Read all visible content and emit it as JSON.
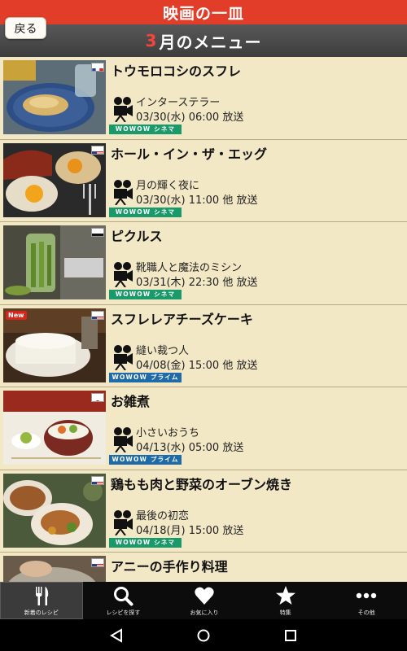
{
  "app": {
    "title": "映画の一皿",
    "back_label": "戻る",
    "month_number": "3",
    "month_suffix": "月のメニュー"
  },
  "colors": {
    "brand_red": "#e13d28",
    "wowow_cinema": "#1a9a6a",
    "wowow_prime": "#1f6aa8"
  },
  "recipes": [
    {
      "title": "トウモロコシのスフレ",
      "movie": "インターステラー",
      "air": "03/30(水) 06:00 放送",
      "channel": "WOWOW シネマ",
      "flag": "france-flag",
      "is_new": false
    },
    {
      "title": "ホール・イン・ザ・エッグ",
      "movie": "月の輝く夜に",
      "air": "03/30(水) 11:00 他 放送",
      "channel": "WOWOW シネマ",
      "flag": "usa-flag",
      "is_new": false
    },
    {
      "title": "ピクルス",
      "movie": "靴職人と魔法のミシン",
      "air": "03/31(木) 22:30 他 放送",
      "channel": "WOWOW シネマ",
      "flag": "germany-flag",
      "is_new": false
    },
    {
      "title": "スフレレアチーズケーキ",
      "movie": "縫い裁つ人",
      "air": "04/08(金) 15:00 他 放送",
      "channel": "WOWOW プライム",
      "flag": "usa-flag",
      "is_new": true,
      "new_label": "New"
    },
    {
      "title": "お雑煮",
      "movie": "小さいおうち",
      "air": "04/13(水) 05:00 放送",
      "channel": "WOWOW プライム",
      "flag": "japan-flag",
      "is_new": false
    },
    {
      "title": "鶏もも肉と野菜のオーブン焼き",
      "movie": "最後の初恋",
      "air": "04/18(月) 15:00 放送",
      "channel": "WOWOW シネマ",
      "flag": "usa-flag",
      "is_new": false
    },
    {
      "title": "アニーの手作り料理",
      "flag": "usa-flag",
      "is_new": false
    }
  ],
  "tabs": [
    {
      "label": "新着のレシピ",
      "icon": "fork-knife-icon",
      "active": true
    },
    {
      "label": "レシピを探す",
      "icon": "search-icon",
      "active": false
    },
    {
      "label": "お気に入り",
      "icon": "heart-icon",
      "active": false
    },
    {
      "label": "特集",
      "icon": "star-icon",
      "active": false
    },
    {
      "label": "その他",
      "icon": "more-icon",
      "active": false
    }
  ],
  "system_nav": [
    "back-icon",
    "home-icon",
    "recents-icon"
  ]
}
